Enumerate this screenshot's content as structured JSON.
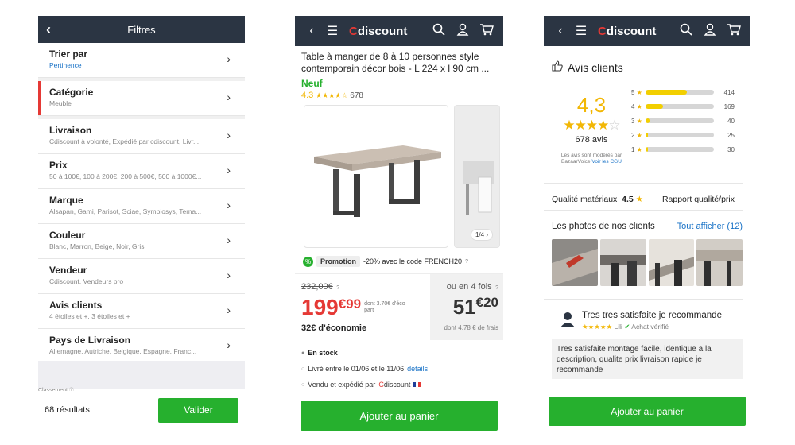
{
  "filters": {
    "header_title": "Filtres",
    "rows": [
      {
        "title": "Trier par",
        "sub": "Pertinence"
      },
      {
        "title": "Catégorie",
        "sub": "Meuble"
      },
      {
        "title": "Livraison",
        "sub": "Cdiscount à volonté, Expédié par cdiscount, Livr..."
      },
      {
        "title": "Prix",
        "sub": "50 à 100€, 100 à 200€, 200 à 500€, 500 à 1000€..."
      },
      {
        "title": "Marque",
        "sub": "Alsapan, Gami, Parisot, Sciae, Symbiosys, Tema..."
      },
      {
        "title": "Couleur",
        "sub": "Blanc, Marron, Beige, Noir, Gris"
      },
      {
        "title": "Vendeur",
        "sub": "Cdiscount, Vendeurs pro"
      },
      {
        "title": "Avis clients",
        "sub": "4 étoiles et +, 3 étoiles et +"
      },
      {
        "title": "Pays de Livraison",
        "sub": "Allemagne, Autriche, Belgique, Espagne, Franc..."
      }
    ],
    "classement": "Classement",
    "results": "68 résultats",
    "validate": "Valider"
  },
  "header": {
    "logo_c": "C",
    "logo_rest": "discount"
  },
  "product": {
    "title": "Table à manger de 8 à 10 personnes style contemporain décor bois - L 224 x l 90 cm ...",
    "condition": "Neuf",
    "rating": "4.3",
    "stars": "★★★★☆",
    "reviews": "678",
    "pager": "1/4",
    "promo_label": "Promotion",
    "promo_text": "-20% avec le code FRENCH20",
    "old_price": "232,00€",
    "price_int": "199",
    "price_cents": "€99",
    "eco": "dont 3.70€ d'éco part",
    "savings": "32€ d'économie",
    "installments": "ou en 4 fois",
    "inst_int": "51",
    "inst_cents": "€20",
    "inst_fees": "dont 4.78 € de frais",
    "stock": "En stock",
    "delivery": "Livré entre le 01/06 et le 11/06",
    "delivery_link": "details",
    "seller_prefix": "Vendu et expédié par",
    "seller_c": "C",
    "seller_rest": "discount",
    "add_to_cart": "Ajouter au panier"
  },
  "reviews": {
    "title": "Avis clients",
    "score": "4,3",
    "stars_full": "★★★★",
    "stars_empty": "☆",
    "count": "678 avis",
    "moderation": "Les avis sont modérés par BazaarVoice",
    "moderation_link": "Voir les CGU",
    "distribution": [
      {
        "stars": "5",
        "count": "414",
        "fraction": 0.61
      },
      {
        "stars": "4",
        "count": "169",
        "fraction": 0.25
      },
      {
        "stars": "3",
        "count": "40",
        "fraction": 0.06
      },
      {
        "stars": "2",
        "count": "25",
        "fraction": 0.04
      },
      {
        "stars": "1",
        "count": "30",
        "fraction": 0.04
      }
    ],
    "quality_label": "Qualité matériaux",
    "quality_score": "4.5",
    "value_label": "Rapport qualité/prix",
    "photos_title": "Les photos de nos clients",
    "photos_link": "Tout afficher (12)",
    "review_title": "Tres tres satisfaite je recommande",
    "review_stars": "★★★★★",
    "review_author": "Lili",
    "review_verified": "Achat vérifié",
    "review_text": "Tres satisfaite montage facile, identique a la description, qualite prix livraison rapide je recommande",
    "add_to_cart": "Ajouter au panier"
  }
}
